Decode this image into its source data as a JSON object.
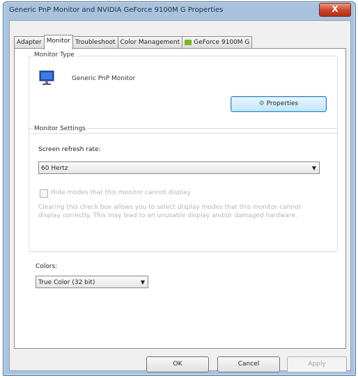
{
  "window": {
    "title": "Generic PnP Monitor and NVIDIA GeForce 9100M G  Properties",
    "close_label": "X"
  },
  "tabs": [
    {
      "label": "Adapter"
    },
    {
      "label": "Monitor"
    },
    {
      "label": "Troubleshoot"
    },
    {
      "label": "Color Management"
    },
    {
      "label": "GeForce 9100M G"
    }
  ],
  "monitor_type": {
    "heading": "Monitor Type",
    "monitor_name": "Generic PnP Monitor",
    "properties_label": "Properties"
  },
  "monitor_settings": {
    "heading": "Monitor Settings",
    "refresh_label": "Screen refresh rate:",
    "refresh_value": "60 Hertz",
    "hide_modes_label": "Hide modes that this monitor cannot display",
    "hide_modes_checked": false,
    "hide_modes_description": "Clearing this check box allows you to select display modes that this monitor cannot display correctly. This may lead to an unusable display and/or damaged hardware."
  },
  "colors": {
    "label": "Colors:",
    "value": "True Color (32 bit)"
  },
  "footer": {
    "ok": "OK",
    "cancel": "Cancel",
    "apply": "Apply"
  }
}
